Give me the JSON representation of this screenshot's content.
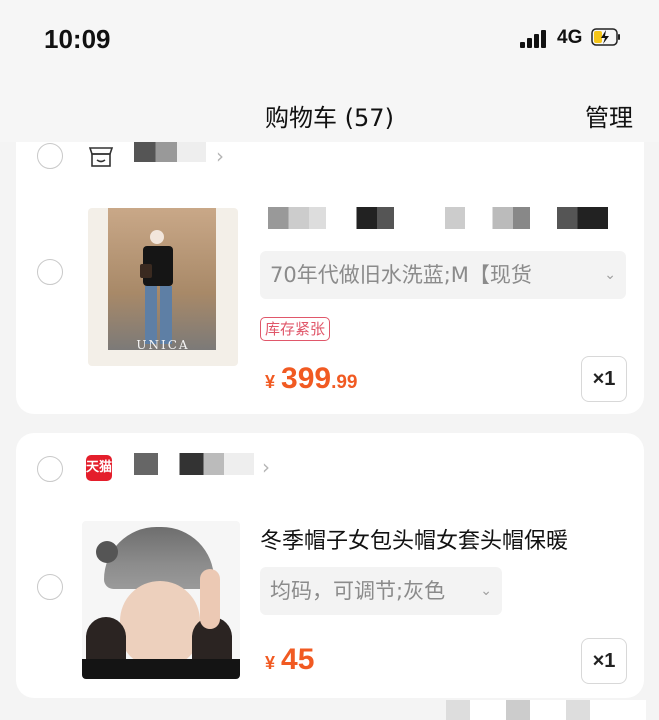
{
  "status_bar": {
    "time": "10:09",
    "network": "4G",
    "battery_icon": "battery-charging-icon",
    "signal_icon": "cellular-signal-icon"
  },
  "nav": {
    "title": "购物车 (57)",
    "manage_label": "管理"
  },
  "items": [
    {
      "store_icon": "store-icon",
      "sku": "70年代做旧水洗蓝;M【现货",
      "tag": "库存紧张",
      "price_symbol": "¥",
      "price_int": "399",
      "price_dec": ".99",
      "quantity": "×1",
      "thumb_watermark": "UNICA"
    },
    {
      "store_icon": "tmall-icon",
      "store_badge": "天猫",
      "title": "冬季帽子女包头帽女套头帽保暖",
      "sku": "均码，可调节;灰色",
      "price_symbol": "¥",
      "price_int": "45",
      "quantity": "×1"
    }
  ]
}
